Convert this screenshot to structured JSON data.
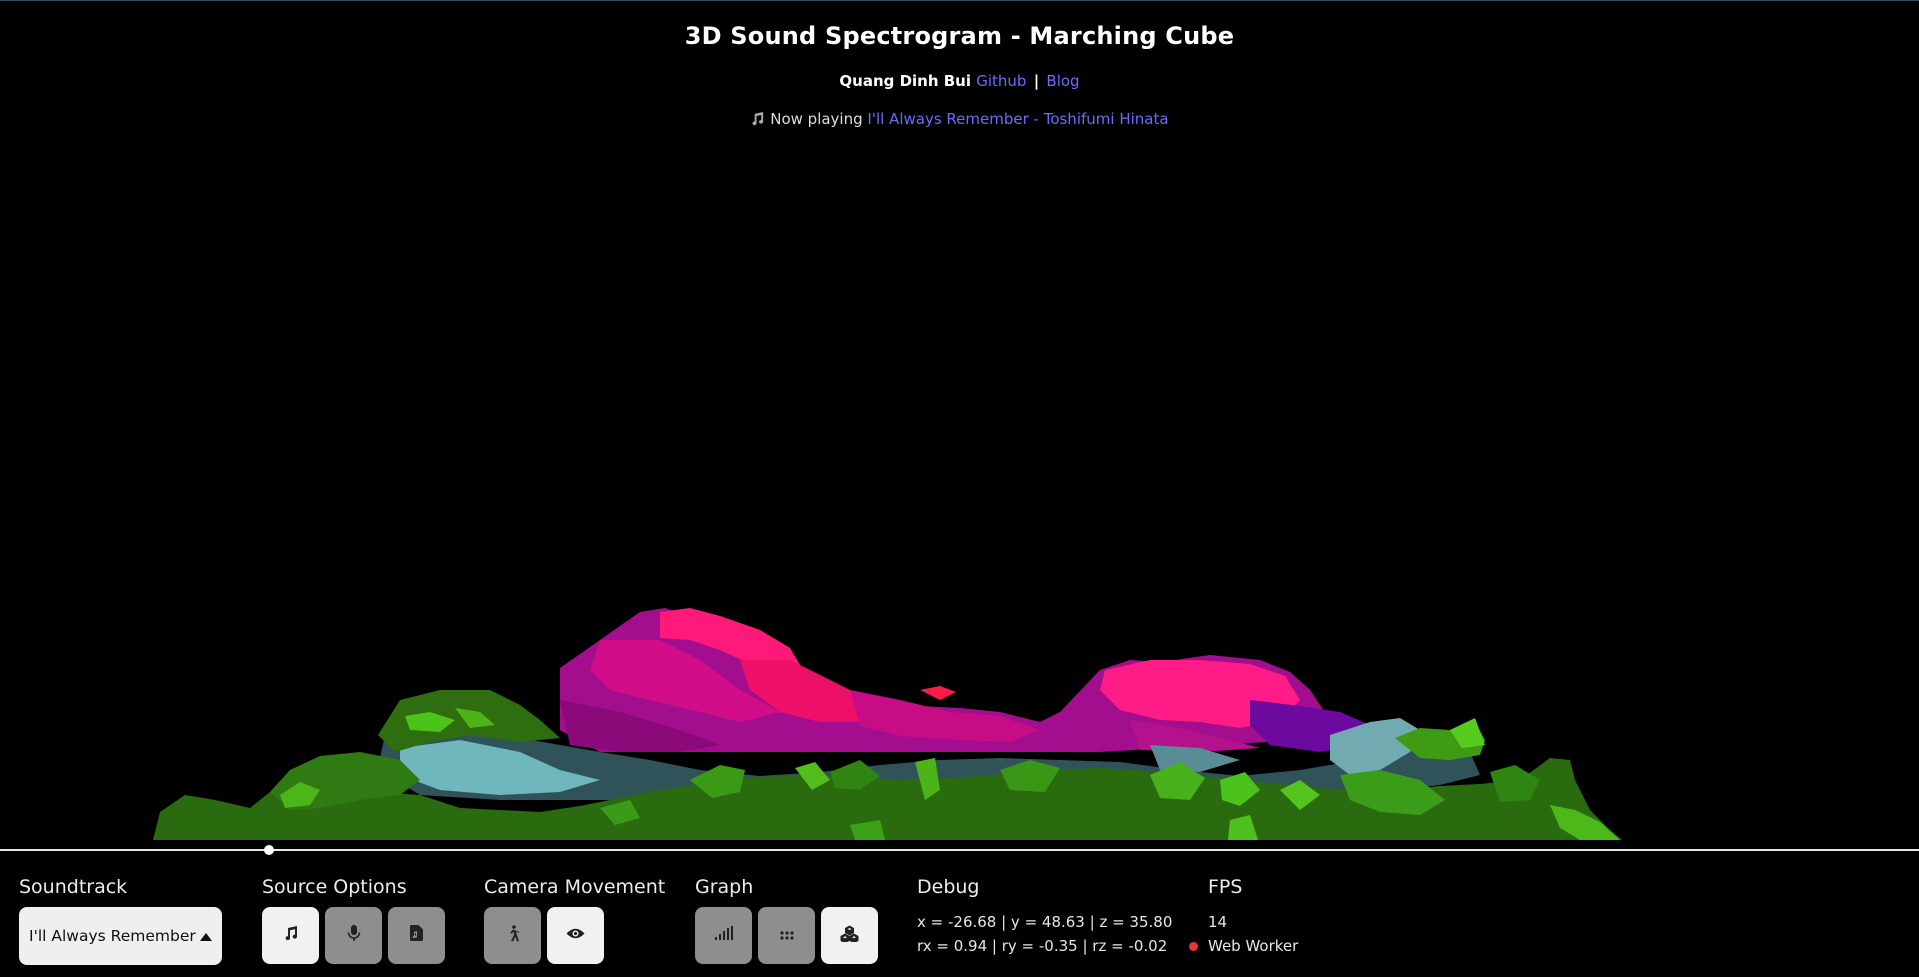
{
  "header": {
    "title": "3D Sound Spectrogram - Marching Cube",
    "author": "Quang Dinh Bui",
    "github_label": "Github",
    "separator": "|",
    "blog_label": "Blog",
    "now_playing_label": "Now playing",
    "track_link": "I'll Always Remember - Toshifumi Hinata"
  },
  "playback": {
    "progress_fraction": 0.14
  },
  "soundtrack": {
    "label": "Soundtrack",
    "selected": "I'll Always Remember",
    "caret_icon": "caret-up-icon"
  },
  "source_options": {
    "label": "Source Options",
    "buttons": [
      {
        "icon": "music-note-icon",
        "active": true
      },
      {
        "icon": "microphone-icon",
        "active": false
      },
      {
        "icon": "audio-file-icon",
        "active": false
      }
    ]
  },
  "camera_movement": {
    "label": "Camera Movement",
    "buttons": [
      {
        "icon": "walking-icon",
        "active": false
      },
      {
        "icon": "eye-icon",
        "active": true
      }
    ]
  },
  "graph": {
    "label": "Graph",
    "buttons": [
      {
        "icon": "signal-bars-icon",
        "active": false
      },
      {
        "icon": "dot-grid-icon",
        "active": false
      },
      {
        "icon": "cubes-icon",
        "active": true
      }
    ]
  },
  "debug": {
    "label": "Debug",
    "position_line": "x = -26.68 | y = 48.63 | z = 35.80",
    "rotation_line": "rx = 0.94 | ry = -0.35 | rz = -0.02"
  },
  "fps": {
    "label": "FPS",
    "value": "14",
    "worker_label": "Web Worker",
    "worker_status_color": "#e53935"
  },
  "colors": {
    "link": "#6b6bff",
    "button_inactive": "#8e8e8e",
    "button_active": "#f1f1f1"
  }
}
